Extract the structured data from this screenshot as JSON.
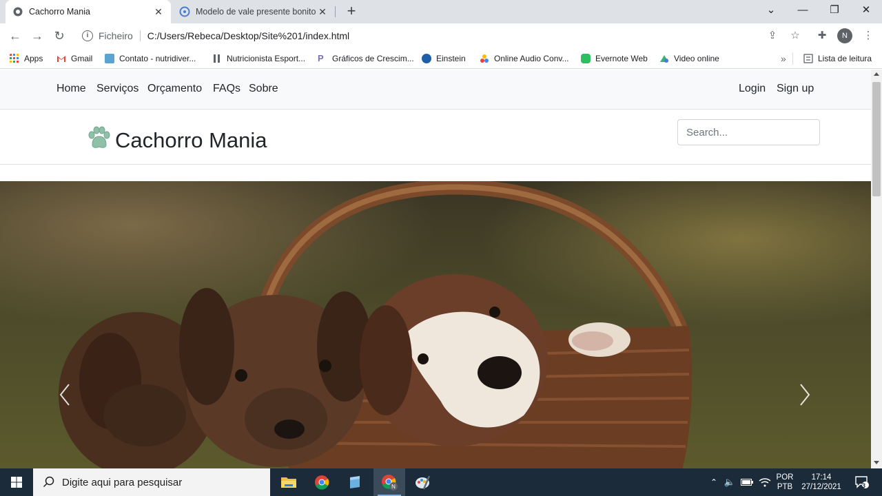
{
  "browser": {
    "tabs": [
      {
        "title": "Cachorro Mania",
        "active": true
      },
      {
        "title": "Modelo de vale presente bonito",
        "active": false
      }
    ],
    "address": {
      "scheme": "Ficheiro",
      "url": "C:/Users/Rebeca/Desktop/Site%201/index.html"
    },
    "profile_initial": "N",
    "bookmarks": [
      {
        "label": "Apps",
        "icon": "apps-grid-icon"
      },
      {
        "label": "Gmail",
        "icon": "gmail-icon"
      },
      {
        "label": "Contato - nutridiver...",
        "icon": "site-icon"
      },
      {
        "label": "Nutricionista Esport...",
        "icon": "site-icon"
      },
      {
        "label": "Gráficos de Crescim...",
        "icon": "site-icon"
      },
      {
        "label": "Einstein",
        "icon": "einstein-icon"
      },
      {
        "label": "Online Audio Conv...",
        "icon": "audio-icon"
      },
      {
        "label": "Evernote Web",
        "icon": "evernote-icon"
      },
      {
        "label": "Video online",
        "icon": "video-icon"
      }
    ],
    "reading_list": "Lista de leitura"
  },
  "page": {
    "nav": {
      "links": [
        "Home",
        "Serviços",
        "Orçamento",
        "FAQs",
        "Sobre"
      ],
      "login": "Login",
      "signup": "Sign up"
    },
    "brand": "Cachorro Mania",
    "search_placeholder": "Search...",
    "hero": {
      "image": "puppies-in-basket",
      "prev_icon": "chevron-left-icon",
      "next_icon": "chevron-right-icon"
    }
  },
  "taskbar": {
    "search_placeholder": "Digite aqui para pesquisar",
    "language": "POR",
    "layout": "PTB",
    "time": "17:14",
    "date": "27/12/2021",
    "notifications": "3"
  },
  "colors": {
    "navbar_bg": "#f8f9fa",
    "paw": "#8fc1a9",
    "taskbar_bg": "#1b2b3a",
    "chrome_tabbar": "#dee1e6"
  }
}
